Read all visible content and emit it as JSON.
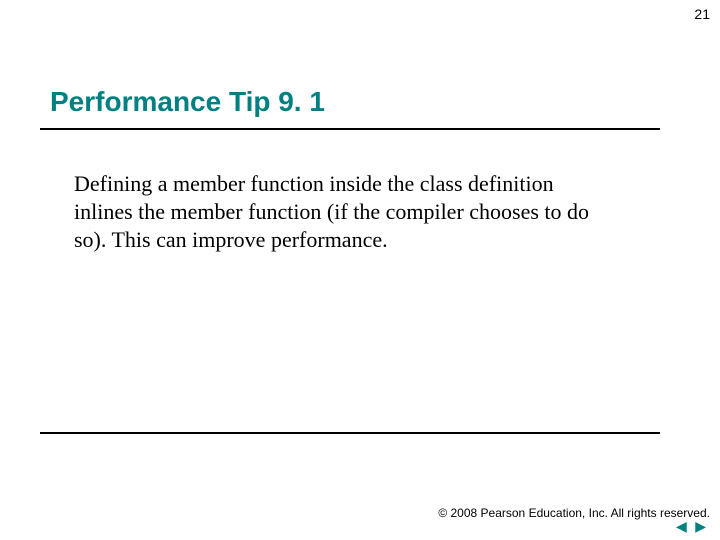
{
  "pageNumber": "21",
  "title": "Performance Tip 9. 1",
  "body": "Defining a member function inside the class definition inlines the member function (if the compiler chooses to do so). This can improve performance.",
  "copyright": "© 2008 Pearson Education, Inc.  All rights reserved.",
  "nav": {
    "prevGlyph": "◀",
    "nextGlyph": "▶"
  }
}
